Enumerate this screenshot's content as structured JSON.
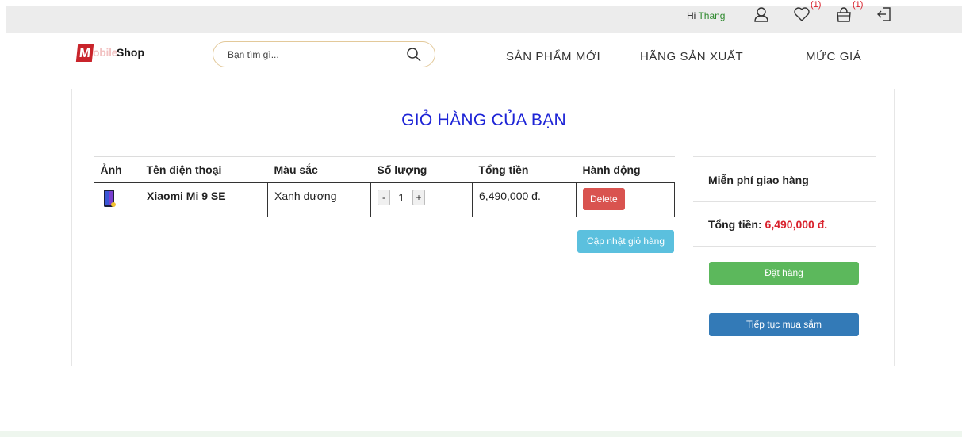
{
  "topbar": {
    "greeting": "Hi ",
    "username": "Thang",
    "wishlist_count": "(1)",
    "cart_count": "(1)",
    "icons": [
      "user-icon",
      "heart-icon",
      "cart-icon",
      "logout-icon"
    ]
  },
  "header": {
    "logo": {
      "m": "M",
      "obile": "obile",
      "shop": "Shop"
    },
    "search_placeholder": "Bạn tìm gì...",
    "nav": [
      "SẢN PHẨM MỚI",
      "HÃNG SẢN XUẤT",
      "MỨC GIÁ"
    ]
  },
  "cart": {
    "title": "GIỎ HÀNG CỦA BẠN",
    "columns": [
      "Ảnh",
      "Tên điện thoại",
      "Màu sắc",
      "Số lượng",
      "Tổng tiền",
      "Hành động"
    ],
    "rows": [
      {
        "name": "Xiaomi Mi 9 SE",
        "color": "Xanh dương",
        "minus": "-",
        "quantity": "1",
        "plus": "+",
        "total": "6,490,000 đ.",
        "action": "Delete"
      }
    ],
    "update_label": "Cập nhật giỏ hàng"
  },
  "summary": {
    "shipping": "Miễn phí giao hàng",
    "total_label": "Tổng tiền: ",
    "total_value": "6,490,000 đ.",
    "order_label": "Đặt hàng",
    "continue_label": "Tiếp tục mua sắm"
  },
  "colors": {
    "title": "#1d24d6",
    "delete": "#d9534f",
    "update": "#5bc0de",
    "order": "#5cb85c",
    "continue": "#337ab7",
    "price": "#d9232e"
  }
}
